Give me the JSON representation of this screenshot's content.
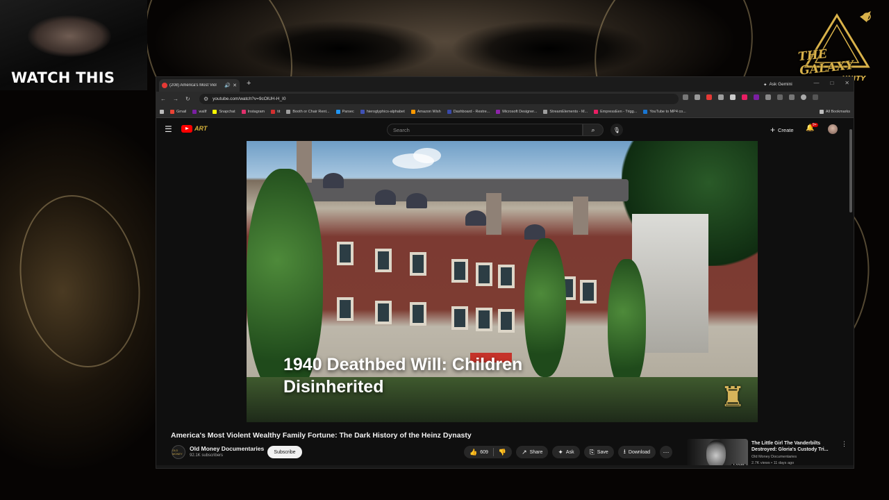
{
  "overlay": {
    "webcam_caption": "WATCH THIS",
    "logo_title": "THE GALAXY",
    "logo_sub": "UNITY"
  },
  "browser": {
    "tab_title": "(208) America's Most Viol",
    "gemini": "Ask Gemini",
    "url": "youtube.com/watch?v=9cOlUH-H_I0",
    "bookmarks": [
      {
        "label": "Gmail",
        "color": "#ea4335"
      },
      {
        "label": "wallf",
        "color": "#7b1fa2"
      },
      {
        "label": "Snapchat",
        "color": "#fffc00"
      },
      {
        "label": "Instagram",
        "color": "#e1306c"
      },
      {
        "label": "tit",
        "color": "#d32f2f"
      },
      {
        "label": "Booth or Chair Rent...",
        "color": "#9e9e9e"
      },
      {
        "label": "Parsec",
        "color": "#2196f3"
      },
      {
        "label": "hieroglyphics-alphabet",
        "color": "#3f51b5"
      },
      {
        "label": "Amazon Wish",
        "color": "#ff9900"
      },
      {
        "label": "Dashboard - Restre...",
        "color": "#3949ab"
      },
      {
        "label": "Microsoft Designer...",
        "color": "#8e24aa"
      },
      {
        "label": "StreamElements - M...",
        "color": "#9e9e9e"
      },
      {
        "label": "EmpressEen - Trigg...",
        "color": "#e91e63"
      },
      {
        "label": "YouTube to MP4 co...",
        "color": "#1976d2"
      }
    ],
    "all_bookmarks": "All Bookmarks"
  },
  "youtube": {
    "search_placeholder": "Search",
    "create_label": "Create",
    "notification_badge": "9+",
    "player_overlay_title": "1940 Deathbed Will: Children Disinherited",
    "video_title": "America's Most Violent Wealthy Family Fortune: The Dark History of the Heinz Dynasty",
    "channel_avatar_text": "OLD MONEY",
    "channel_name": "Old Money Documentaries",
    "subscribers": "92.1K subscribers",
    "subscribe_label": "Subscribe",
    "likes": "609",
    "share_label": "Share",
    "ask_label": "Ask",
    "save_label": "Save",
    "download_label": "Download",
    "recommendation": {
      "title": "The Little Girl The Vanderbilts Destroyed: Gloria's Custody Tri...",
      "channel": "Old Money Documentaries",
      "meta": "2.7K views • 11 days ago",
      "duration": "1:10:55"
    }
  }
}
